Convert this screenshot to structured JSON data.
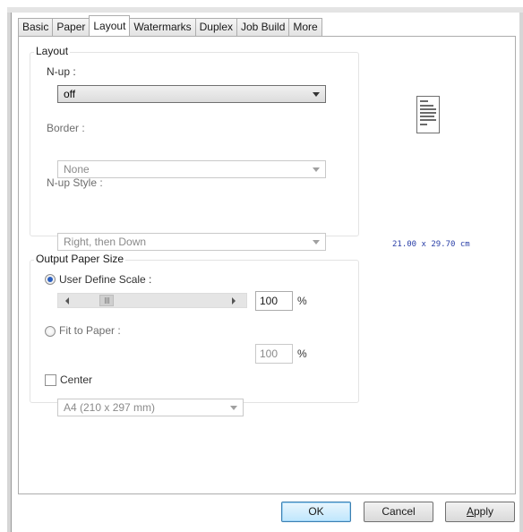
{
  "tabs": [
    "Basic",
    "Paper",
    "Layout",
    "Watermarks",
    "Duplex",
    "Job Build",
    "More"
  ],
  "layout": {
    "title": "Layout",
    "nup_label": "N-up :",
    "nup_value": "off",
    "border_label": "Border :",
    "border_value": "None",
    "nup_style_label": "N-up Style :",
    "nup_style_value": "Right, then Down"
  },
  "output": {
    "title": "Output Paper Size",
    "user_scale_label": "User Define Scale :",
    "scale_value": "100",
    "percent": "%",
    "fit_label": "Fit to Paper :",
    "paper_value": "A4 (210 x 297 mm)",
    "fit_value": "100",
    "center_label": "Center"
  },
  "preview": {
    "size_text": "21.00 x 29.70 cm"
  },
  "buttons": {
    "ok": "OK",
    "cancel": "Cancel",
    "apply_prefix": "",
    "apply_underlined": "A",
    "apply_rest": "pply"
  },
  "colors": {
    "dims_text": "#2b40a8",
    "radio_selected": "#2b5fbf",
    "default_button": "#bee6fd"
  }
}
